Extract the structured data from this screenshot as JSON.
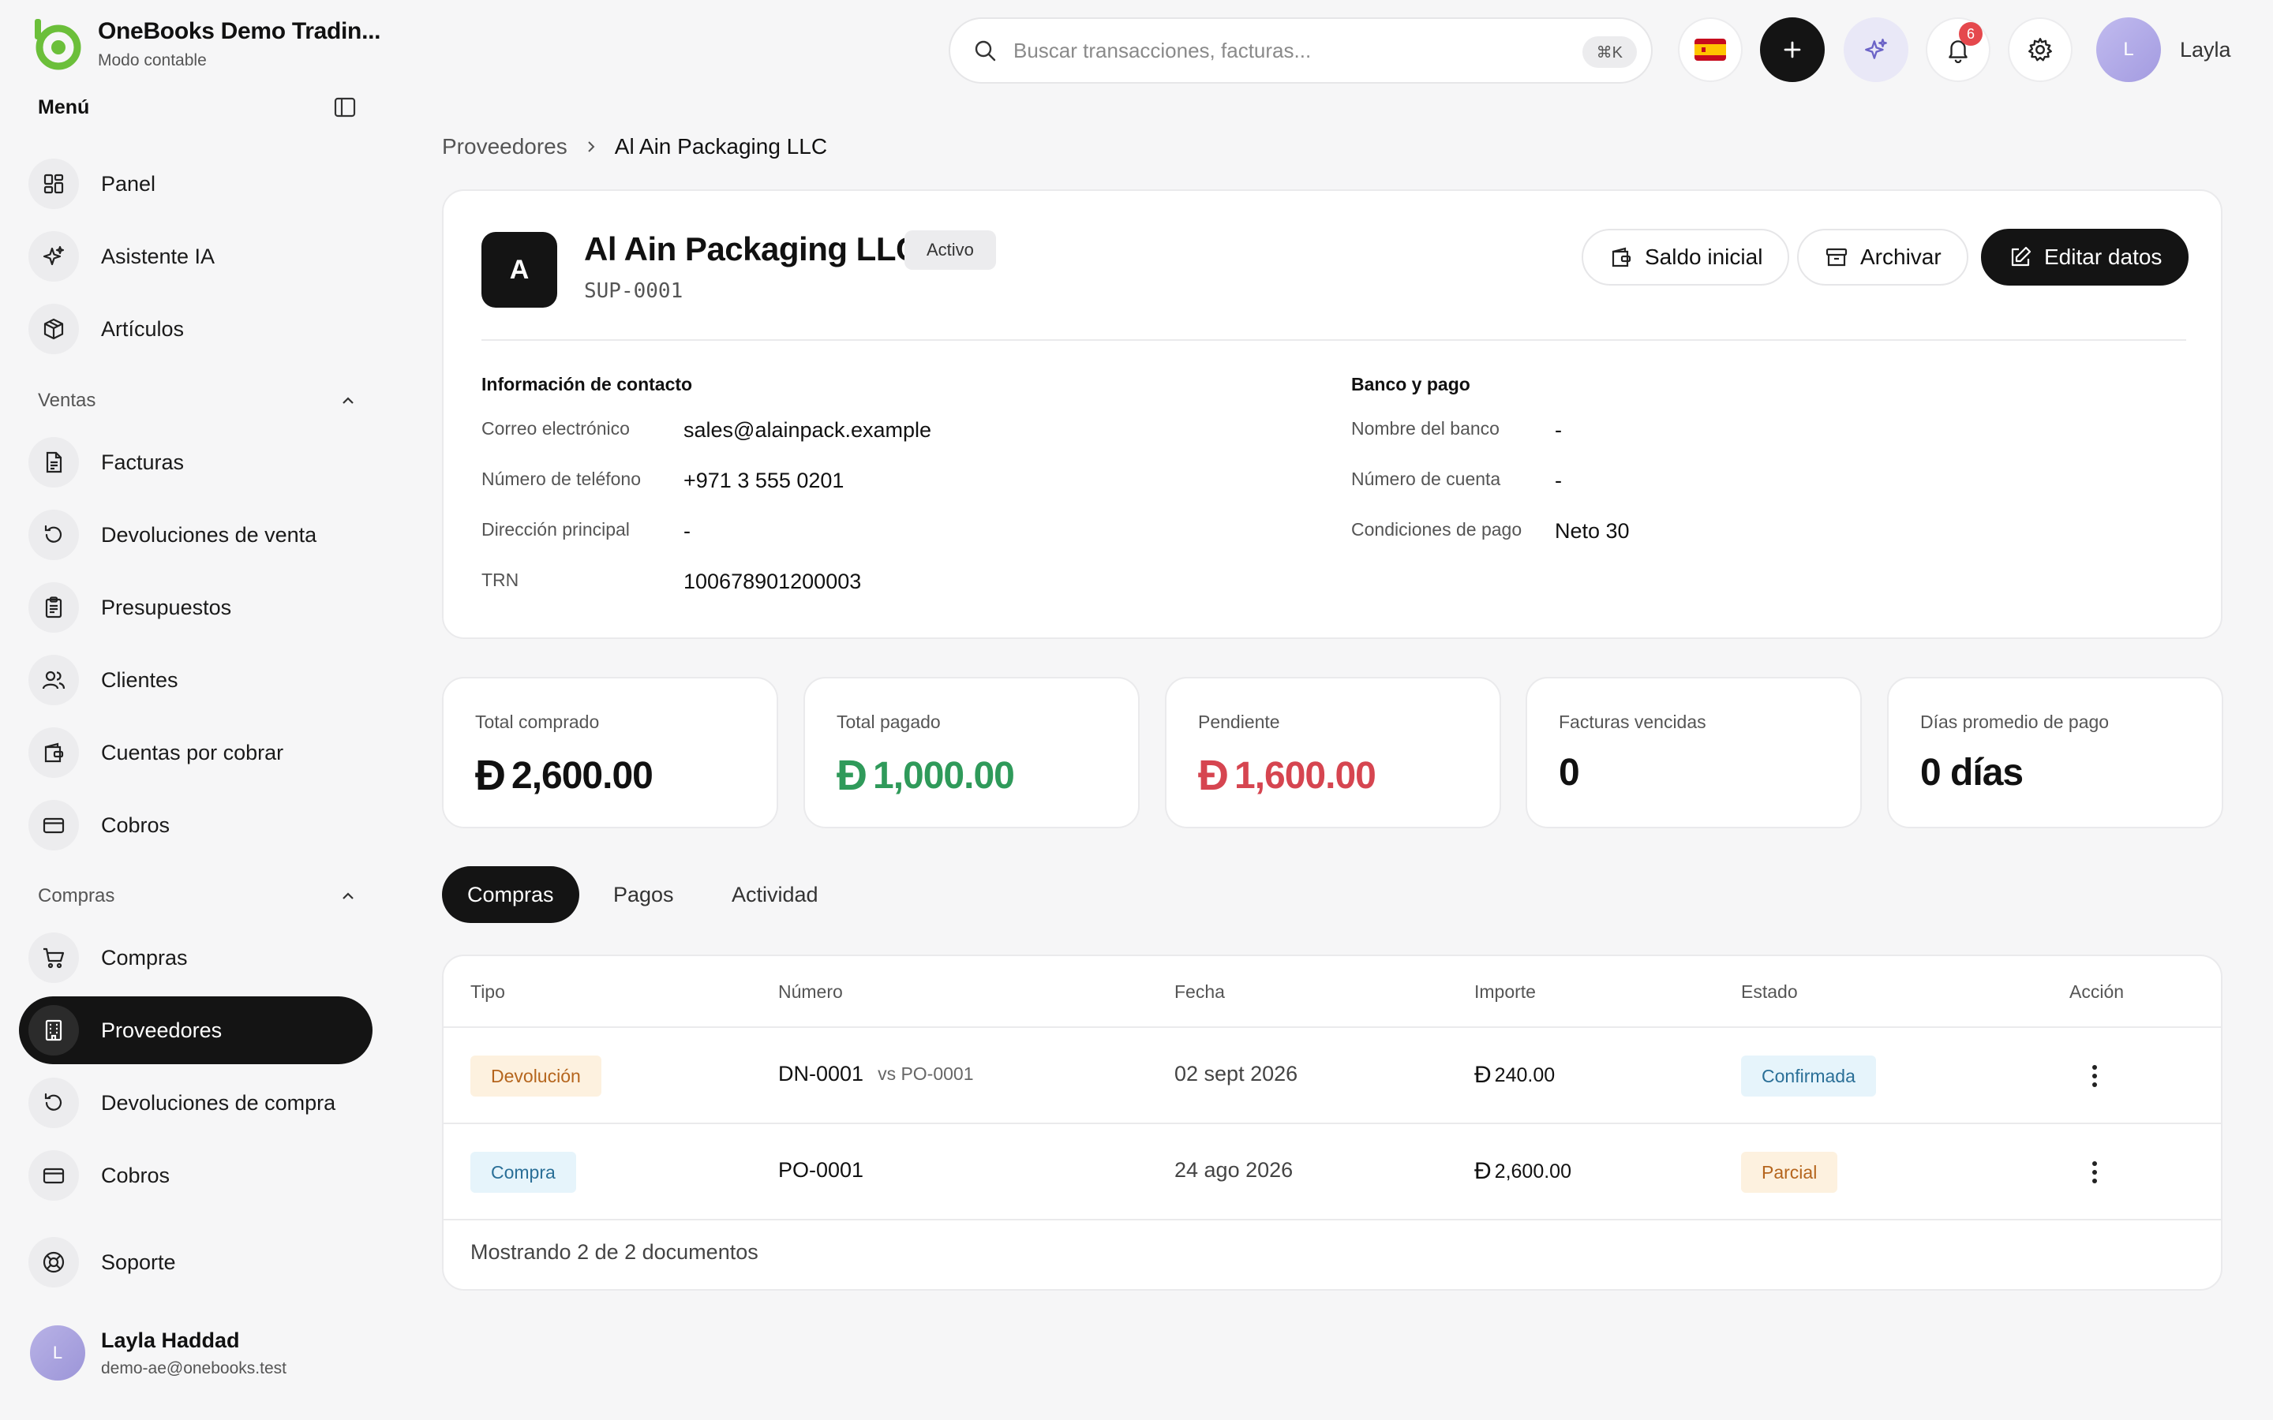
{
  "brand": {
    "name": "OneBooks Demo Tradin...",
    "mode": "Modo contable"
  },
  "menu": {
    "title": "Menú"
  },
  "sidebar": {
    "top_items": [
      {
        "label": "Panel",
        "icon": "dashboard-icon"
      },
      {
        "label": "Asistente IA",
        "icon": "sparkle-icon"
      },
      {
        "label": "Artículos",
        "icon": "box-icon"
      }
    ],
    "sales": {
      "title": "Ventas",
      "items": [
        {
          "label": "Facturas",
          "icon": "invoice-icon"
        },
        {
          "label": "Devoluciones de venta",
          "icon": "return-icon"
        },
        {
          "label": "Presupuestos",
          "icon": "clipboard-icon"
        },
        {
          "label": "Clientes",
          "icon": "users-icon"
        },
        {
          "label": "Cuentas por cobrar",
          "icon": "wallet-icon"
        },
        {
          "label": "Cobros",
          "icon": "card-icon"
        }
      ]
    },
    "purchases": {
      "title": "Compras",
      "items": [
        {
          "label": "Compras",
          "icon": "cart-icon"
        },
        {
          "label": "Proveedores",
          "icon": "building-icon",
          "active": true
        },
        {
          "label": "Devoluciones de compra",
          "icon": "return-icon"
        },
        {
          "label": "Cobros",
          "icon": "card-icon"
        }
      ]
    },
    "support": {
      "label": "Soporte",
      "icon": "lifebuoy-icon"
    }
  },
  "user": {
    "initial": "L",
    "name": "Layla Haddad",
    "email": "demo-ae@onebooks.test",
    "short_name": "Layla"
  },
  "search": {
    "placeholder": "Buscar transacciones, facturas...",
    "shortcut": "⌘K"
  },
  "notifications": {
    "count": "6"
  },
  "breadcrumb": {
    "parent": "Proveedores",
    "current": "Al Ain Packaging LLC"
  },
  "supplier": {
    "initial": "A",
    "name": "Al Ain Packaging LLC",
    "status": "Activo",
    "code": "SUP-0001",
    "actions": {
      "opening_balance": "Saldo inicial",
      "archive": "Archivar",
      "edit": "Editar datos"
    },
    "contact": {
      "title": "Información de contacto",
      "email_label": "Correo electrónico",
      "email": "sales@alainpack.example",
      "phone_label": "Número de teléfono",
      "phone": "+971 3 555 0201",
      "address_label": "Dirección principal",
      "address": "-",
      "trn_label": "TRN",
      "trn": "100678901200003"
    },
    "bank": {
      "title": "Banco y pago",
      "bank_label": "Nombre del banco",
      "bank": "-",
      "account_label": "Número de cuenta",
      "account": "-",
      "terms_label": "Condiciones de pago",
      "terms": "Neto 30"
    }
  },
  "stats": {
    "currency_symbol": "Đ",
    "total_purchased": {
      "label": "Total comprado",
      "value": "2,600.00"
    },
    "total_paid": {
      "label": "Total pagado",
      "value": "1,000.00"
    },
    "pending": {
      "label": "Pendiente",
      "value": "1,600.00"
    },
    "overdue": {
      "label": "Facturas vencidas",
      "value": "0"
    },
    "avg_days": {
      "label": "Días promedio de pago",
      "value": "0 días"
    }
  },
  "tabs": [
    "Compras",
    "Pagos",
    "Actividad"
  ],
  "table": {
    "headers": {
      "type": "Tipo",
      "number": "Número",
      "date": "Fecha",
      "amount": "Importe",
      "status": "Estado",
      "action": "Acción"
    },
    "rows": [
      {
        "type": "Devolución",
        "number": "DN-0001",
        "ref": "vs PO-0001",
        "date": "02 sept 2026",
        "amount": "240.00",
        "status": "Confirmada"
      },
      {
        "type": "Compra",
        "number": "PO-0001",
        "ref": "",
        "date": "24 ago 2026",
        "amount": "2,600.00",
        "status": "Parcial"
      }
    ],
    "footer": "Mostrando 2 de 2 documentos"
  },
  "colors": {
    "accent_green": "#6bbf3a",
    "paid_green": "#2f9a5a",
    "pending_red": "#d64550",
    "dark": "#141414"
  }
}
